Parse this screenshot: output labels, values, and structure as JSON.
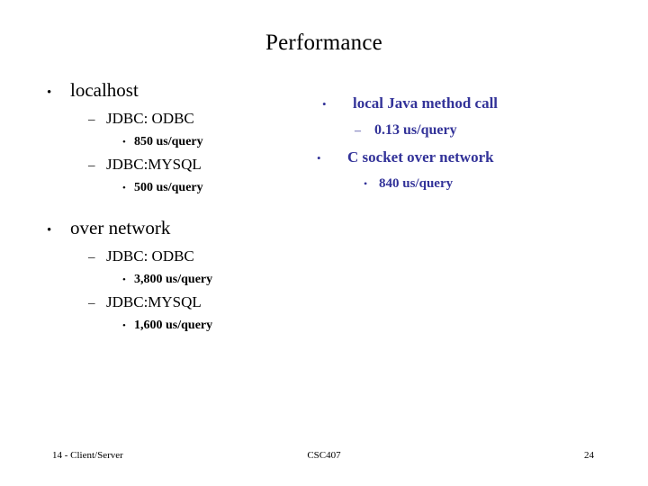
{
  "slide": {
    "title": "Performance",
    "accent_color": "#333399",
    "text_color": "#000000",
    "background_color": "#ffffff"
  },
  "bullets": {
    "round": "•",
    "dash": "–"
  },
  "left_column": {
    "groups": [
      {
        "heading": "localhost",
        "entries": [
          {
            "label": "JDBC: ODBC",
            "value": "850 us/query"
          },
          {
            "label": "JDBC:MYSQL",
            "value": "500 us/query"
          }
        ]
      },
      {
        "heading": "over network",
        "entries": [
          {
            "label": "JDBC: ODBC",
            "value": "3,800 us/query"
          },
          {
            "label": "JDBC:MYSQL",
            "value": "1,600 us/query"
          }
        ]
      }
    ]
  },
  "right_column": {
    "items": [
      {
        "label": "local Java method call",
        "sub": "0.13 us/query",
        "sub_marker": "dash"
      },
      {
        "label": "C socket over network",
        "sub": "840 us/query",
        "sub_marker": "round"
      }
    ]
  },
  "footer": {
    "left": "14 - Client/Server",
    "center": "CSC407",
    "page_number": "24"
  }
}
